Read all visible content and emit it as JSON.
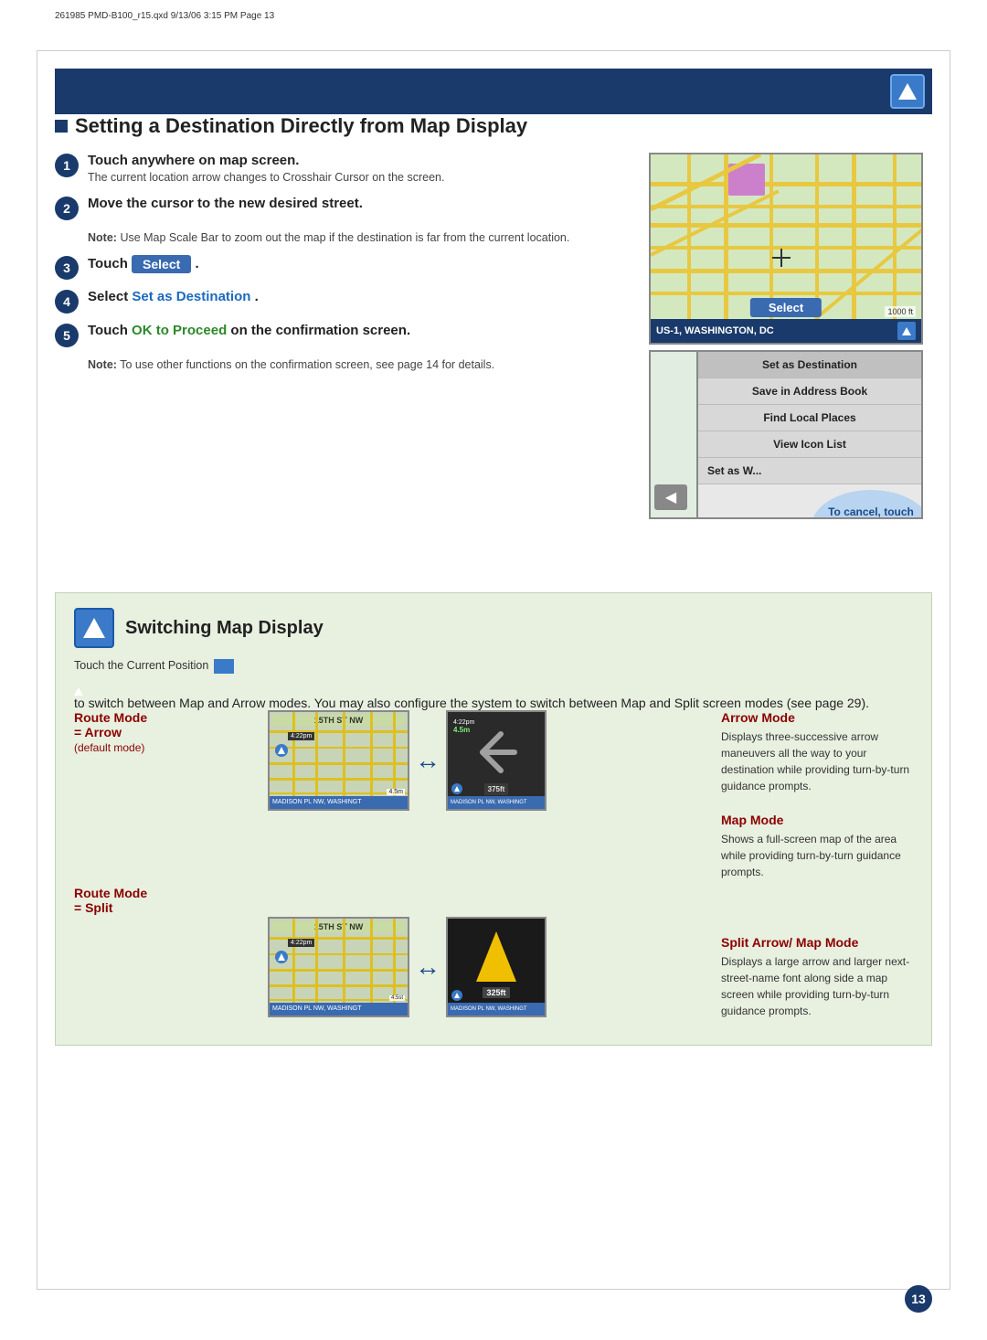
{
  "meta": {
    "print_info": "261985 PMD-B100_r15.qxd   9/13/06   3:15 PM   Page 13",
    "page_number": "13"
  },
  "header": {
    "title": "Setting a Destination Directly from Map Display"
  },
  "steps": [
    {
      "number": "1",
      "main": "Touch anywhere on map screen.",
      "sub": "The current location arrow changes to Crosshair Cursor on the screen."
    },
    {
      "number": "2",
      "main": "Move the cursor to the new desired street."
    },
    {
      "number": "3",
      "main_prefix": "Touch",
      "select_label": "Select",
      "main_suffix": "."
    },
    {
      "number": "4",
      "main_prefix": "Select",
      "highlight_text": "Set as Destination",
      "main_suffix": "."
    },
    {
      "number": "5",
      "main_prefix": "Touch",
      "highlight_text": "OK to Proceed",
      "main_suffix": " on the confirmation screen."
    }
  ],
  "notes": [
    {
      "id": "note1",
      "label": "Note:",
      "text": " Use Map Scale Bar to zoom out the map if the destination is far from the current location."
    },
    {
      "id": "note2",
      "label": "Note:",
      "text": " To use other functions on the confirmation screen, see page 14 for details."
    }
  ],
  "map1": {
    "select_label": "Select",
    "location_text": "US-1, WASHINGTON, DC"
  },
  "map2": {
    "menu_items": [
      "Set as Destination",
      "Save in Address Book",
      "Find Local Places",
      "View Icon List",
      "Set as Wa..."
    ]
  },
  "cancel_callout": {
    "text": "To cancel, touch Previous Screen icon."
  },
  "switching": {
    "title": "Switching Map Display",
    "desc_prefix": "Touch the Current Position",
    "desc_middle": " to switch between Map and Arrow modes. You may also configure the system to switch between Map and Split screen modes (see page 29).",
    "route_mode_arrow": {
      "label": "Route Mode\n= Arrow\n(default mode)"
    },
    "route_mode_split": {
      "label": "Route Mode\n= Split"
    },
    "map_mode": {
      "title": "Map Mode",
      "desc": "Shows a full-screen map of the area while providing turn-by-turn guidance prompts."
    },
    "arrow_mode": {
      "title": "Arrow Mode",
      "desc": "Displays three-successive arrow maneuvers all the way to your destination while providing turn-by-turn guidance prompts."
    },
    "split_arrow_mode": {
      "title": "Split Arrow/ Map Mode",
      "desc": "Displays a large arrow and larger next-street-name font along side a map screen while providing turn-by-turn guidance prompts."
    },
    "map_label": "15TH ST NW",
    "bottom_bar_text": "MADISON PL NW, WASHINGT"
  }
}
